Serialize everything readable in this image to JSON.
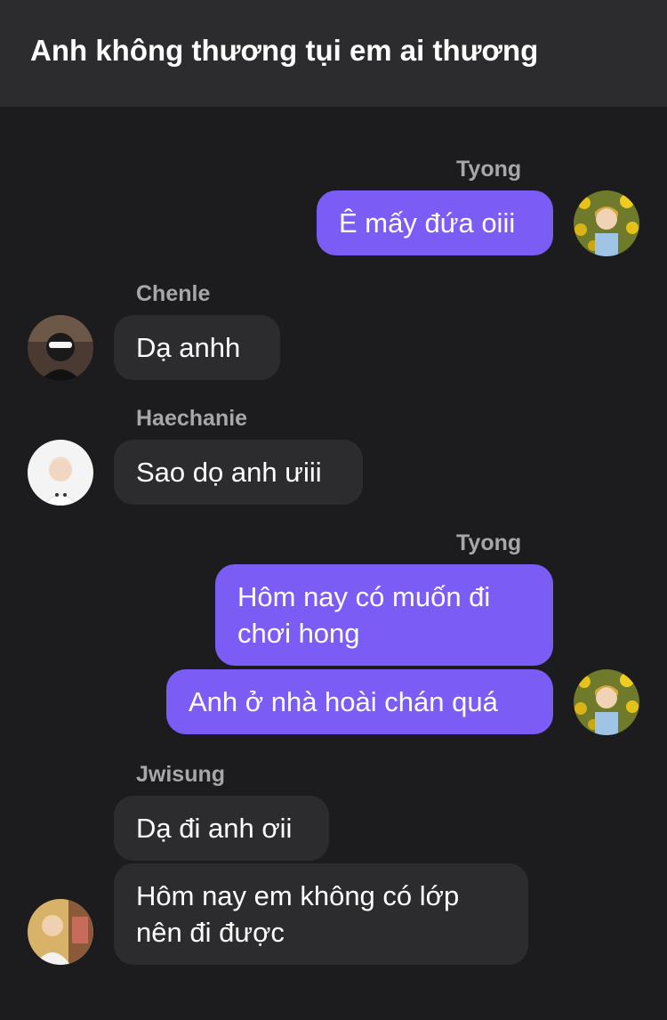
{
  "header": {
    "title": "Anh không thương tụi em ai thương"
  },
  "messages": [
    {
      "sender": "Tyong",
      "texts": [
        "Ê mấy đứa oiii"
      ],
      "direction": "out"
    },
    {
      "sender": "Chenle",
      "texts": [
        "Dạ anhh"
      ],
      "direction": "in"
    },
    {
      "sender": "Haechanie",
      "texts": [
        "Sao dọ anh ưiii"
      ],
      "direction": "in"
    },
    {
      "sender": "Tyong",
      "texts": [
        "Hôm nay có muốn đi chơi hong",
        "Anh ở nhà hoài chán quá"
      ],
      "direction": "out"
    },
    {
      "sender": "Jwisung",
      "texts": [
        "Dạ đi anh ơii",
        "Hôm nay em không có lớp nên đi được"
      ],
      "direction": "in"
    }
  ],
  "colors": {
    "background": "#1c1c1e",
    "header": "#2c2c2e",
    "outgoing_bubble": "#7b5cf5",
    "incoming_bubble": "#2c2c2e",
    "sender_name": "#a7a7ab"
  }
}
